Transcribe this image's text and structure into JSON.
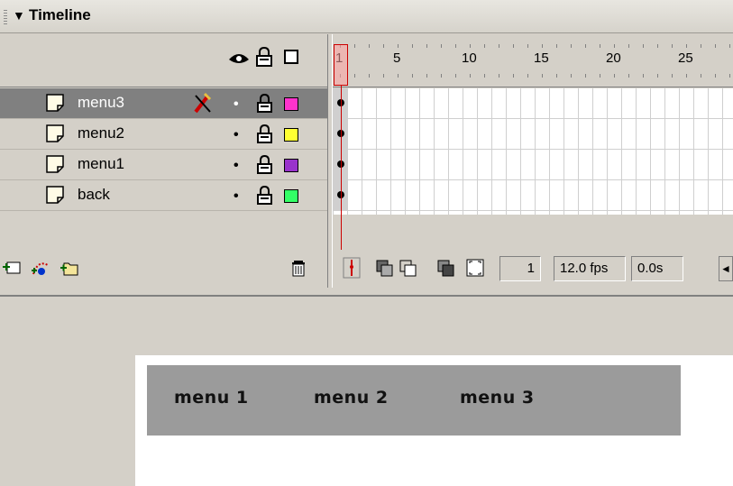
{
  "panel": {
    "title": "Timeline",
    "collapse_arrow": "▼"
  },
  "header_icons": {
    "eye": "eye-icon",
    "lock": "lock-icon",
    "outline": "outline-icon"
  },
  "ruler": {
    "labels": [
      "1",
      "5",
      "10",
      "15",
      "20",
      "25"
    ]
  },
  "layers": [
    {
      "name": "menu3",
      "selected": true,
      "color": "#ff33cc",
      "visibility_dot": "•",
      "has_pencil": true
    },
    {
      "name": "menu2",
      "selected": false,
      "color": "#ffff33",
      "visibility_dot": "•",
      "has_pencil": false
    },
    {
      "name": "menu1",
      "selected": false,
      "color": "#9933cc",
      "visibility_dot": "•",
      "has_pencil": false
    },
    {
      "name": "back",
      "selected": false,
      "color": "#33ff66",
      "visibility_dot": "•",
      "has_pencil": false
    }
  ],
  "layer_toolbar": {
    "icons": [
      "insert-layer-icon",
      "add-motion-guide-icon",
      "insert-layer-folder-icon",
      "delete-layer-icon"
    ]
  },
  "frame_toolbar": {
    "icons": [
      "center-frame-icon",
      "onion-skin-icon",
      "onion-skin-outlines-icon",
      "edit-multiple-frames-icon",
      "modify-onion-markers-icon"
    ],
    "current_frame": "1",
    "frame_rate": "12.0 fps",
    "elapsed_time": "0.0s",
    "scroll_left": "◄"
  },
  "stage": {
    "menu_items": [
      "menu 1",
      "menu 2",
      "menu 3"
    ],
    "menu_bar_color": "#9b9b9b"
  }
}
